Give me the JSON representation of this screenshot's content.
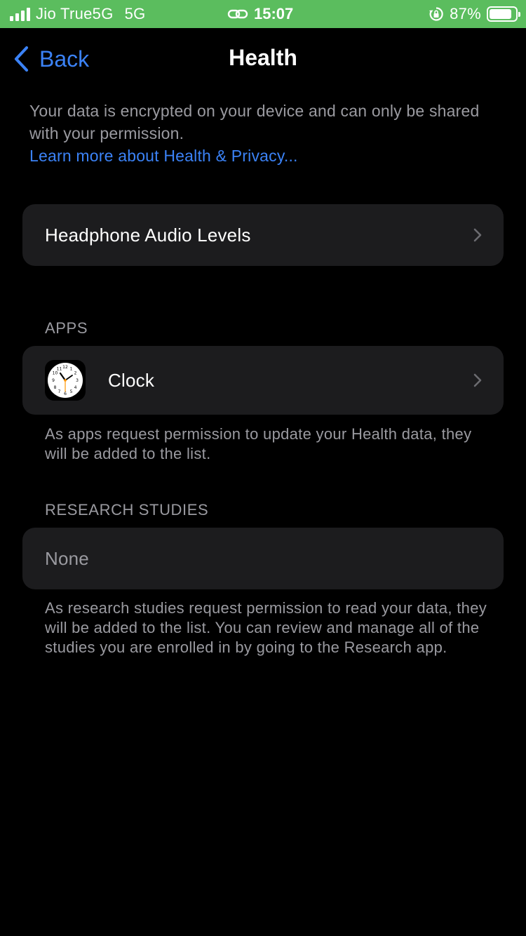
{
  "status_bar": {
    "carrier": "Jio True5G",
    "network": "5G",
    "time": "15:07",
    "battery_percent": "87%",
    "battery_level": 0.87,
    "background_color": "#5bbd5e"
  },
  "nav": {
    "back_label": "Back",
    "title": "Health"
  },
  "intro": {
    "text": "Your data is encrypted on your device and can only be shared with your permission.",
    "link": "Learn more about Health & Privacy..."
  },
  "headphone": {
    "label": "Headphone Audio Levels"
  },
  "apps": {
    "header": "APPS",
    "items": [
      {
        "label": "Clock",
        "icon": "clock-icon"
      }
    ],
    "footer": "As apps request permission to update your Health data, they will be added to the list."
  },
  "research": {
    "header": "RESEARCH STUDIES",
    "none_label": "None",
    "footer": "As research studies request permission to read your data, they will be added to the list. You can review and manage all of the studies you are enrolled in by going to the Research app."
  },
  "colors": {
    "accent": "#3b82f6",
    "cell_background": "#1c1c1e",
    "secondary_text": "#9a9aa0"
  }
}
